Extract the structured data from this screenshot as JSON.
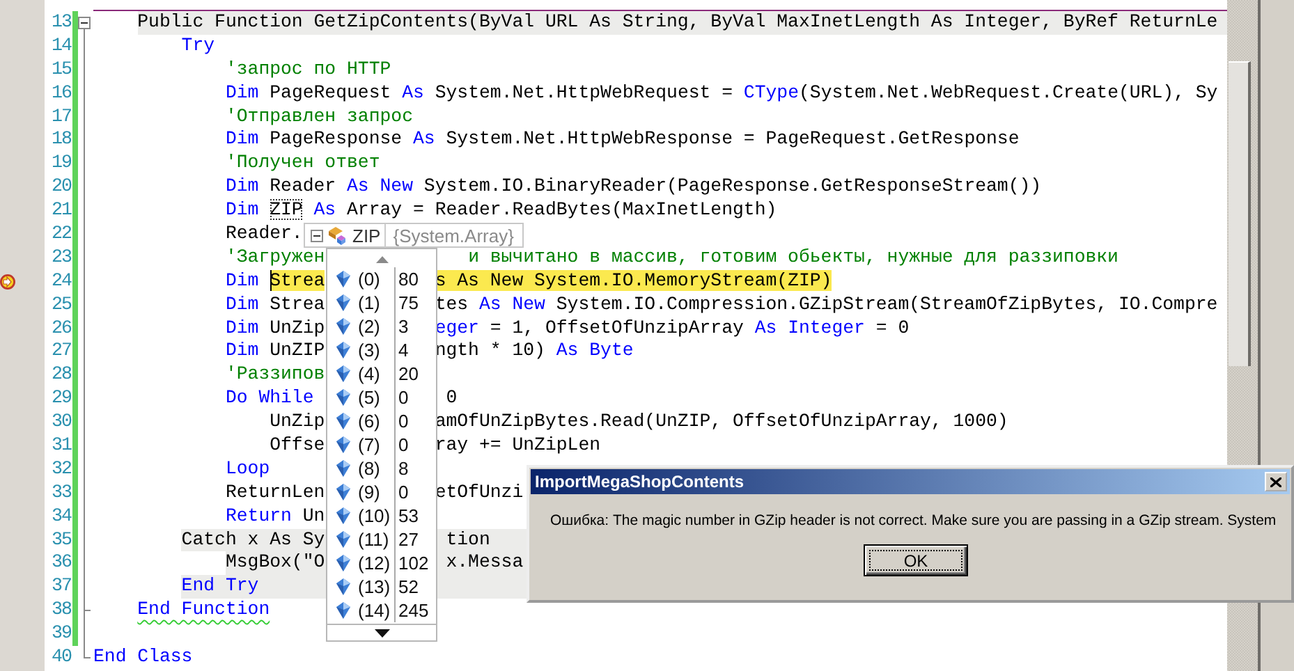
{
  "editor": {
    "lines": [
      {
        "number": "13",
        "kind": "block-start",
        "shaded": true,
        "current": false,
        "changed": true,
        "pieces": [
          [
            {
              "text": "Public Function GetZipContents(ByVal URL As String, ByVal MaxInetLength As Integer, ByRef ReturnLe",
              "kind": "plain"
            }
          ]
        ]
      },
      {
        "number": "14",
        "kind": "code",
        "shaded": false,
        "current": false,
        "changed": true,
        "pieces": [
          [
            {
              "text": "Try",
              "kind": "keyword"
            }
          ]
        ]
      },
      {
        "number": "15",
        "kind": "code",
        "shaded": false,
        "current": false,
        "changed": true,
        "pieces": [
          [
            {
              "text": "'запрос по HTTP",
              "kind": "comment"
            }
          ]
        ]
      },
      {
        "number": "16",
        "kind": "code",
        "shaded": false,
        "current": false,
        "changed": true,
        "pieces": [
          [
            {
              "text": "Dim",
              "kind": "keyword"
            },
            {
              "text": " PageRequest ",
              "kind": "plain"
            },
            {
              "text": "As",
              "kind": "keyword"
            },
            {
              "text": " System.Net.HttpWebRequest = ",
              "kind": "plain"
            },
            {
              "text": "CType",
              "kind": "keyword"
            },
            {
              "text": "(System.Net.WebRequest.Create(URL), Sy",
              "kind": "plain"
            }
          ]
        ]
      },
      {
        "number": "17",
        "kind": "code",
        "shaded": false,
        "current": false,
        "changed": true,
        "pieces": [
          [
            {
              "text": "'Отправлен запрос",
              "kind": "comment"
            }
          ]
        ]
      },
      {
        "number": "18",
        "kind": "code",
        "shaded": false,
        "current": false,
        "changed": true,
        "pieces": [
          [
            {
              "text": "Dim",
              "kind": "keyword"
            },
            {
              "text": " PageResponse ",
              "kind": "plain"
            },
            {
              "text": "As",
              "kind": "keyword"
            },
            {
              "text": " System.Net.HttpWebResponse = PageRequest.GetResponse",
              "kind": "plain"
            }
          ]
        ]
      },
      {
        "number": "19",
        "kind": "code",
        "shaded": false,
        "current": false,
        "changed": true,
        "pieces": [
          [
            {
              "text": "'Получен ответ",
              "kind": "comment"
            }
          ]
        ]
      },
      {
        "number": "20",
        "kind": "code",
        "shaded": false,
        "current": false,
        "changed": true,
        "pieces": [
          [
            {
              "text": "Dim",
              "kind": "keyword"
            },
            {
              "text": " Reader ",
              "kind": "plain"
            },
            {
              "text": "As New",
              "kind": "keyword"
            },
            {
              "text": " System.IO.BinaryReader(PageResponse.GetResponseStream())",
              "kind": "plain"
            }
          ]
        ]
      },
      {
        "number": "21",
        "kind": "code",
        "shaded": false,
        "current": false,
        "changed": true,
        "pieces": [
          [
            {
              "text": "Dim ",
              "kind": "keyword"
            },
            {
              "text": "ZIP",
              "kind": "hovered"
            },
            {
              "text": " As",
              "kind": "keyword"
            },
            {
              "text": " Array = Reader.ReadBytes(MaxInetLength)",
              "kind": "plain"
            }
          ]
        ]
      },
      {
        "number": "22",
        "kind": "code",
        "shaded": false,
        "current": false,
        "changed": true,
        "pieces": [
          [
            {
              "text": "Reader.",
              "kind": "plain"
            }
          ]
        ]
      },
      {
        "number": "23",
        "kind": "code",
        "shaded": false,
        "current": false,
        "changed": true,
        "pieces": [
          [
            {
              "text": "'Загружен",
              "kind": "comment"
            }
          ],
          [
            {
              "text": "и вычитано в массив, готовим обьекты, нужные для раззиповки",
              "kind": "comment"
            }
          ]
        ]
      },
      {
        "number": "24",
        "kind": "code",
        "shaded": false,
        "current": true,
        "changed": true,
        "pieces": [
          [
            {
              "text": "Dim ",
              "kind": "keyword"
            },
            {
              "text": "Strea",
              "kind": "current"
            }
          ],
          [
            {
              "text": "s As New System.IO.MemoryStream(ZIP)",
              "kind": "current"
            }
          ]
        ]
      },
      {
        "number": "25",
        "kind": "code",
        "shaded": false,
        "current": false,
        "changed": true,
        "pieces": [
          [
            {
              "text": "Dim",
              "kind": "keyword"
            },
            {
              "text": " Strea",
              "kind": "plain"
            }
          ],
          [
            {
              "text": "tes ",
              "kind": "plain"
            },
            {
              "text": "As New",
              "kind": "keyword"
            },
            {
              "text": " System.IO.Compression.GZipStream(StreamOfZipBytes, IO.Compre",
              "kind": "plain"
            }
          ]
        ]
      },
      {
        "number": "26",
        "kind": "code",
        "shaded": false,
        "current": false,
        "changed": true,
        "pieces": [
          [
            {
              "text": "Dim",
              "kind": "keyword"
            },
            {
              "text": " UnZip",
              "kind": "plain"
            }
          ],
          [
            {
              "text": "eger",
              "kind": "keyword"
            },
            {
              "text": " = 1, OffsetOfUnzipArray ",
              "kind": "plain"
            },
            {
              "text": "As Integer",
              "kind": "keyword"
            },
            {
              "text": " = 0",
              "kind": "plain"
            }
          ]
        ]
      },
      {
        "number": "27",
        "kind": "code",
        "shaded": false,
        "current": false,
        "changed": true,
        "pieces": [
          [
            {
              "text": "Dim",
              "kind": "keyword"
            },
            {
              "text": " UnZIP",
              "kind": "plain"
            }
          ],
          [
            {
              "text": "ngth * 10) ",
              "kind": "plain"
            },
            {
              "text": "As Byte",
              "kind": "keyword"
            }
          ]
        ]
      },
      {
        "number": "28",
        "kind": "code",
        "shaded": false,
        "current": false,
        "changed": true,
        "pieces": [
          [
            {
              "text": "'Раззипов",
              "kind": "comment"
            }
          ]
        ]
      },
      {
        "number": "29",
        "kind": "code",
        "shaded": false,
        "current": false,
        "changed": true,
        "pieces": [
          [
            {
              "text": "Do While",
              "kind": "keyword"
            }
          ],
          [
            {
              "text": "0",
              "kind": "plain"
            }
          ]
        ]
      },
      {
        "number": "30",
        "kind": "code",
        "shaded": false,
        "current": false,
        "changed": true,
        "pieces": [
          [
            {
              "text": "UnZip",
              "kind": "plain"
            }
          ],
          [
            {
              "text": "amOfUnZipBytes.Read(UnZIP, OffsetOfUnzipArray, 1000)",
              "kind": "plain"
            }
          ]
        ]
      },
      {
        "number": "31",
        "kind": "code",
        "shaded": false,
        "current": false,
        "changed": true,
        "pieces": [
          [
            {
              "text": "Offse",
              "kind": "plain"
            }
          ],
          [
            {
              "text": "ray += UnZipLen",
              "kind": "plain"
            }
          ]
        ]
      },
      {
        "number": "32",
        "kind": "code",
        "shaded": false,
        "current": false,
        "changed": true,
        "pieces": [
          [
            {
              "text": "Loop",
              "kind": "keyword"
            }
          ]
        ]
      },
      {
        "number": "33",
        "kind": "code",
        "shaded": false,
        "current": false,
        "changed": true,
        "pieces": [
          [
            {
              "text": "ReturnLen",
              "kind": "plain"
            }
          ],
          [
            {
              "text": "etOfUnzi",
              "kind": "plain"
            }
          ]
        ]
      },
      {
        "number": "34",
        "kind": "code",
        "shaded": false,
        "current": false,
        "changed": true,
        "pieces": [
          [
            {
              "text": "Return",
              "kind": "keyword"
            },
            {
              "text": " Un",
              "kind": "plain"
            }
          ]
        ]
      },
      {
        "number": "35",
        "kind": "code",
        "shaded": true,
        "current": false,
        "changed": true,
        "pieces": [
          [
            {
              "text": "Catch x As Sy",
              "kind": "plain"
            }
          ],
          [
            {
              "text": "tion",
              "kind": "plain"
            }
          ]
        ]
      },
      {
        "number": "36",
        "kind": "code",
        "shaded": true,
        "current": false,
        "changed": true,
        "pieces": [
          [
            {
              "text": "MsgBox(\"O",
              "kind": "plain"
            }
          ],
          [
            {
              "text": "x.Messa",
              "kind": "plain"
            }
          ]
        ]
      },
      {
        "number": "37",
        "kind": "code",
        "shaded": true,
        "current": false,
        "changed": true,
        "pieces": [
          [
            {
              "text": "End Try",
              "kind": "keyword"
            }
          ]
        ]
      },
      {
        "number": "38",
        "kind": "block-end",
        "shaded": false,
        "current": false,
        "changed": true,
        "pieces": [
          [
            {
              "text": "End Function",
              "kind": "keyword-warning"
            }
          ]
        ]
      },
      {
        "number": "39",
        "kind": "code",
        "shaded": false,
        "current": false,
        "changed": true
      },
      {
        "number": "40",
        "kind": "block-end",
        "shaded": false,
        "current": false,
        "changed": false,
        "pieces": [
          [
            {
              "text": "End Class",
              "kind": "keyword"
            }
          ]
        ]
      }
    ]
  },
  "watch": {
    "expanded": true,
    "name": "ZIP",
    "value": "{System.Array}",
    "items": [
      {
        "index": "(0)",
        "value": "80"
      },
      {
        "index": "(1)",
        "value": "75"
      },
      {
        "index": "(2)",
        "value": "3"
      },
      {
        "index": "(3)",
        "value": "4"
      },
      {
        "index": "(4)",
        "value": "20"
      },
      {
        "index": "(5)",
        "value": "0"
      },
      {
        "index": "(6)",
        "value": "0"
      },
      {
        "index": "(7)",
        "value": "0"
      },
      {
        "index": "(8)",
        "value": "8"
      },
      {
        "index": "(9)",
        "value": "0"
      },
      {
        "index": "(10)",
        "value": "53"
      },
      {
        "index": "(11)",
        "value": "27"
      },
      {
        "index": "(12)",
        "value": "102"
      },
      {
        "index": "(13)",
        "value": "52"
      },
      {
        "index": "(14)",
        "value": "245"
      }
    ]
  },
  "dialog": {
    "title": "ImportMegaShopContents",
    "message": "Ошибка: The magic number in GZip header is not correct. Make sure you are passing in a GZip stream. System",
    "buttons": [
      "OK"
    ]
  }
}
